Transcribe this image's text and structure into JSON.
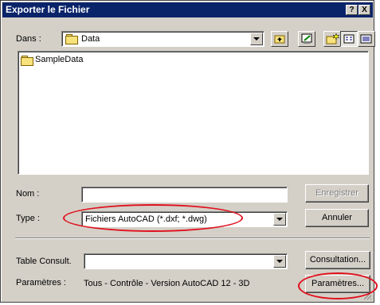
{
  "window": {
    "title": "Exporter le Fichier",
    "help_label": "?",
    "close_label": "X"
  },
  "location": {
    "label": "Dans :",
    "value": "Data"
  },
  "files": [
    {
      "name": "SampleData",
      "icon": "folder-icon"
    }
  ],
  "name_field": {
    "label": "Nom :",
    "value": ""
  },
  "type_field": {
    "label": "Type :",
    "value": "Fichiers AutoCAD (*.dxf; *.dwg)"
  },
  "table_field": {
    "label": "Table Consult.",
    "value": ""
  },
  "params": {
    "label": "Paramètres :",
    "value": "Tous - Contrôle - Version AutoCAD 12 - 3D"
  },
  "buttons": {
    "save": "Enregistrer",
    "cancel": "Annuler",
    "consultation": "Consultation...",
    "parameters": "Paramètres..."
  },
  "colors": {
    "title_bg": "#0a246a",
    "dialog_bg": "#d4d0c8",
    "highlight_ellipse": "#e0101c"
  }
}
